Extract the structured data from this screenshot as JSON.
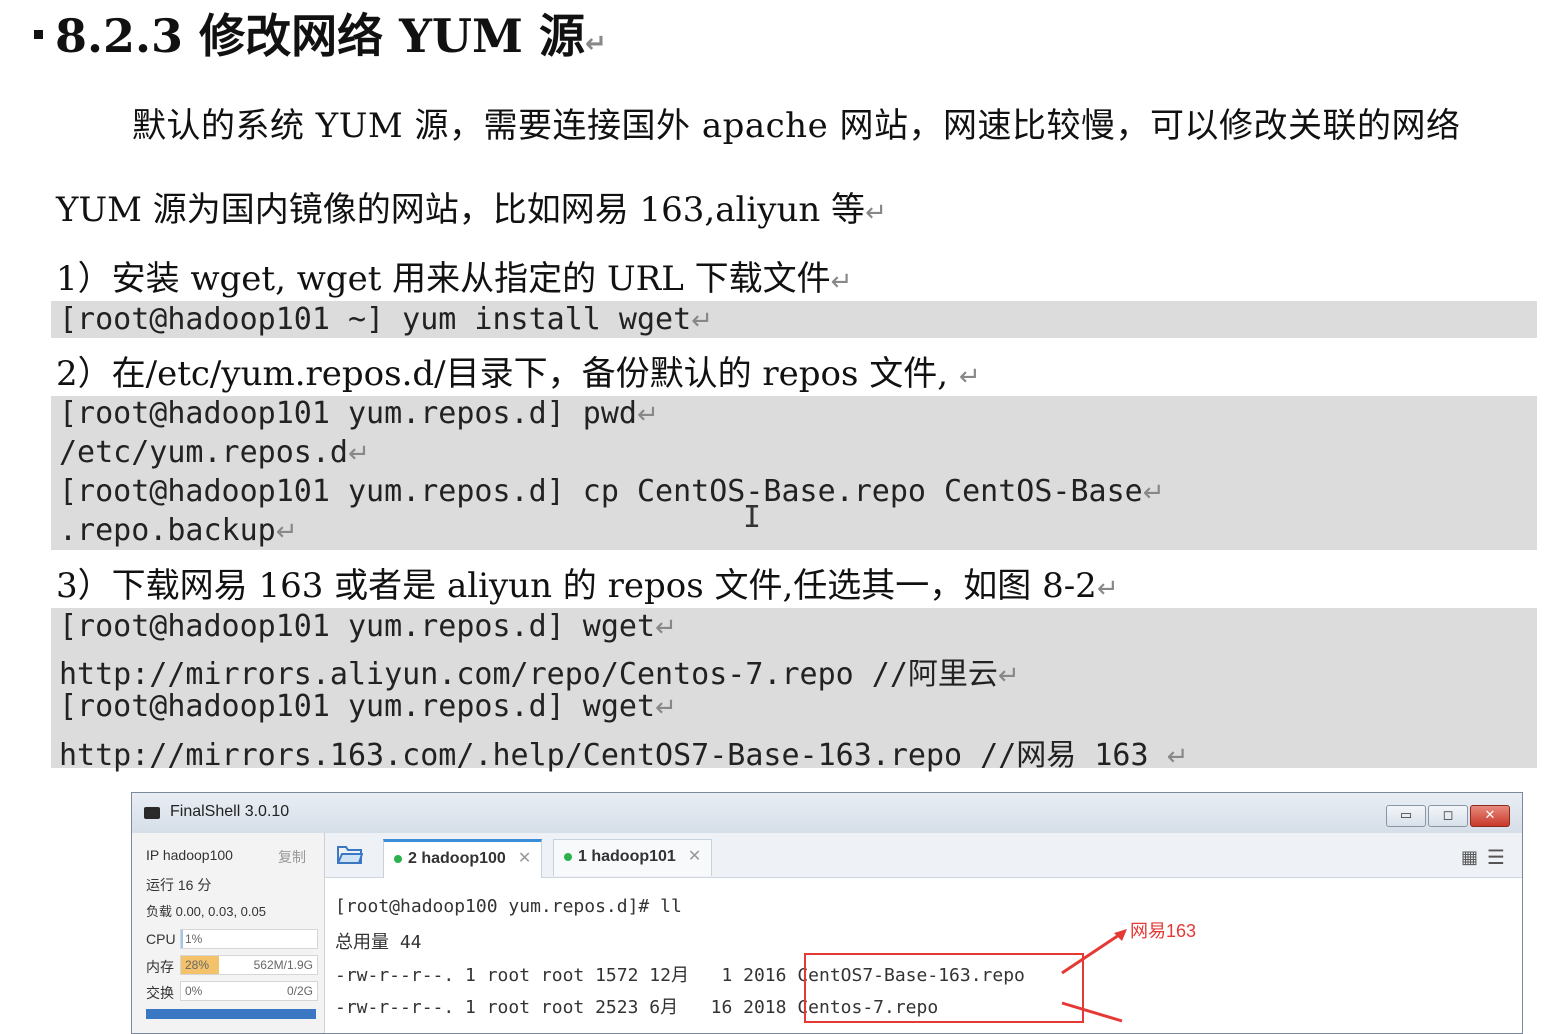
{
  "section": {
    "number": "8.2.3",
    "title": "修改网络 YUM 源",
    "return_mark": "↵"
  },
  "intro": {
    "line1": "默认的系统 YUM 源，需要连接国外 apache 网站，网速比较慢，可以修改关联的网络",
    "line2": "YUM 源为国内镜像的网站，比如网易 163,aliyun 等"
  },
  "steps": [
    {
      "label": "1）安装 wget, wget 用来从指定的 URL 下载文件",
      "code": [
        "[root@hadoop101 ~] yum install wget"
      ]
    },
    {
      "label": "2）在/etc/yum.repos.d/目录下，备份默认的 repos 文件,",
      "code": [
        "[root@hadoop101 yum.repos.d] pwd",
        "/etc/yum.repos.d",
        "[root@hadoop101 yum.repos.d] cp CentOS-Base.repo   CentOS-Base",
        ".repo.backup"
      ]
    },
    {
      "label": "3）下载网易 163 或者是 aliyun 的 repos 文件,任选其一，如图 8-2",
      "code": [
        "[root@hadoop101 yum.repos.d] wget",
        " http://mirrors.aliyun.com/repo/Centos-7.repo  //阿里云",
        "[root@hadoop101 yum.repos.d] wget",
        " http://mirrors.163.com/.help/CentOS7-Base-163.repo //网易 163 "
      ]
    }
  ],
  "finalshell": {
    "window_title": "FinalShell 3.0.10",
    "sidebar": {
      "ip_label": "IP hadoop100",
      "copy_label": "复制",
      "uptime": "运行 16 分",
      "load": "负载 0.00, 0.03, 0.05",
      "cpu_label": "CPU",
      "cpu_value": "1%",
      "mem_label": "内存",
      "mem_percent": "28%",
      "mem_usage": "562M/1.9G",
      "swap_label": "交换",
      "swap_percent": "0%",
      "swap_usage": "0/2G"
    },
    "tabs": [
      {
        "label": "2 hadoop100",
        "active": true
      },
      {
        "label": "1 hadoop101",
        "active": false
      }
    ],
    "terminal": [
      "[root@hadoop100 yum.repos.d]# ll",
      "总用量 44",
      "-rw-r--r--. 1 root root 1572 12月   1 2016 CentOS7-Base-163.repo",
      "-rw-r--r--. 1 root root 2523 6月   16 2018 Centos-7.repo"
    ],
    "annotation": "网易163",
    "colors": {
      "annotation": "#e53935",
      "active_tab_accent": "#3b8fd8",
      "status_dot": "#2bb24c",
      "mem_fill": "#f3c26b"
    }
  }
}
